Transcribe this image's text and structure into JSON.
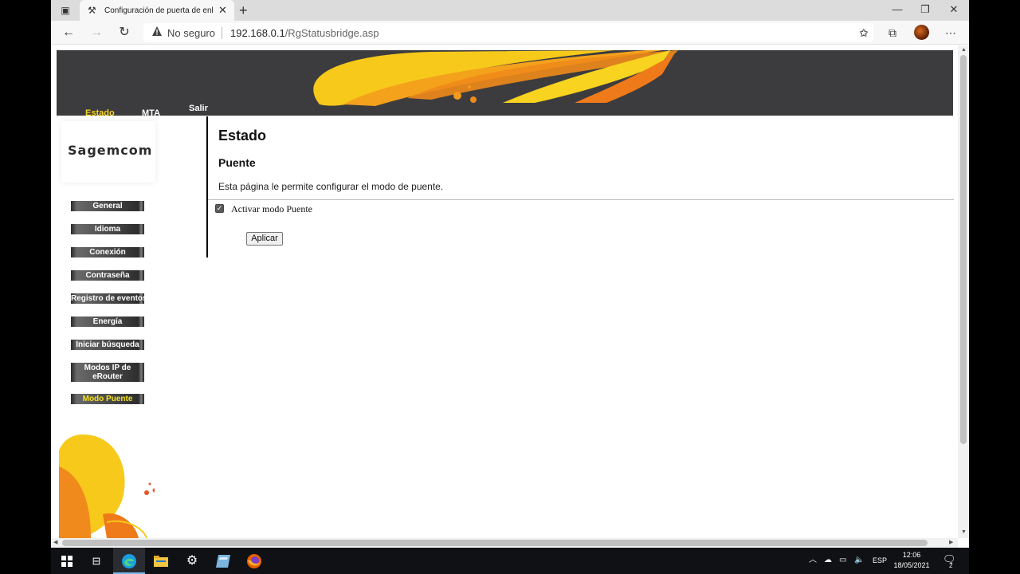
{
  "browser": {
    "tab_title": "Configuración de puerta de enla",
    "tab_close": "✕",
    "new_tab": "+",
    "security_label": "No seguro",
    "url_host": "192.168.0.1",
    "url_path": "/RgStatusbridge.asp",
    "window_controls": {
      "minimize": "—",
      "maximize": "❐",
      "close": "✕"
    }
  },
  "router": {
    "brand": "Sagemcom",
    "top_nav": [
      {
        "label": "Estado",
        "active": true
      },
      {
        "label": "MTA",
        "active": false
      },
      {
        "label": "Salir",
        "active": false
      }
    ],
    "sidebar": [
      {
        "label": "General"
      },
      {
        "label": "Idioma"
      },
      {
        "label": "Conexión"
      },
      {
        "label": "Contraseña"
      },
      {
        "label": "Registro de eventos"
      },
      {
        "label": "Energía"
      },
      {
        "label": "Iniciar búsqueda"
      },
      {
        "label": "Modos IP de eRouter"
      },
      {
        "label": "Modo Puente",
        "active": true
      }
    ],
    "page_title": "Estado",
    "section_title": "Puente",
    "description": "Esta página le permite configurar el modo de puente.",
    "bridge_checkbox_label": "Activar modo Puente",
    "bridge_enabled": true,
    "apply_label": "Aplicar"
  },
  "taskbar": {
    "language": "ESP",
    "time": "12:06",
    "date": "18/05/2021",
    "notification_count": "2"
  },
  "colors": {
    "banner": "#3c3c3e",
    "accent_yellow": "#f7d21d",
    "orange": "#f08a1c"
  }
}
